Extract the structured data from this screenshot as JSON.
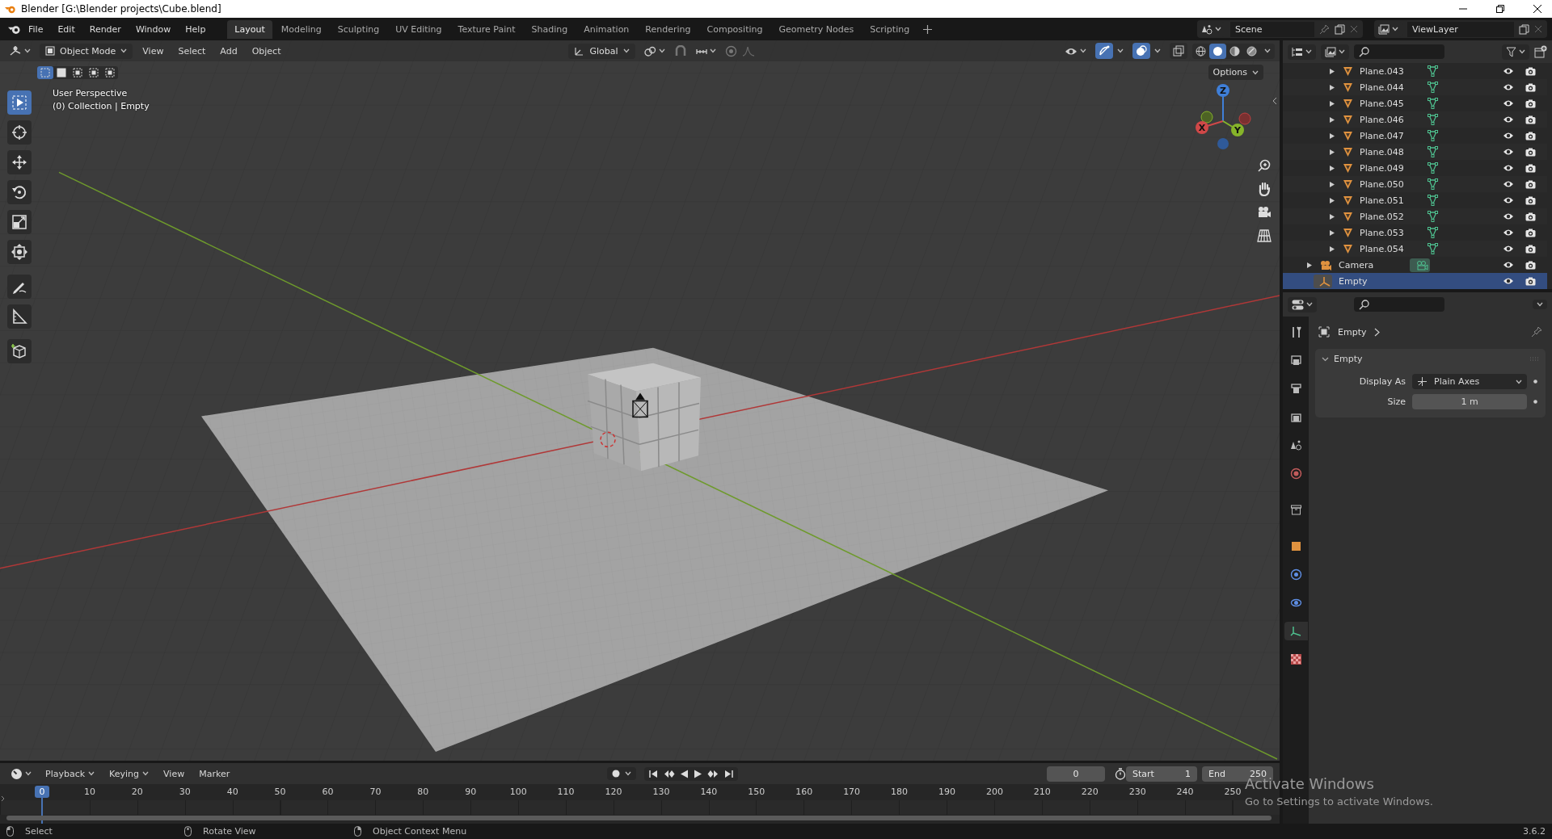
{
  "window": {
    "title": "Blender [G:\\Blender projects\\Cube.blend]"
  },
  "menu": [
    "File",
    "Edit",
    "Render",
    "Window",
    "Help"
  ],
  "workspaces": [
    {
      "label": "Layout",
      "selected": true
    },
    {
      "label": "Modeling",
      "selected": false
    },
    {
      "label": "Sculpting",
      "selected": false
    },
    {
      "label": "UV Editing",
      "selected": false
    },
    {
      "label": "Texture Paint",
      "selected": false
    },
    {
      "label": "Shading",
      "selected": false
    },
    {
      "label": "Animation",
      "selected": false
    },
    {
      "label": "Rendering",
      "selected": false
    },
    {
      "label": "Compositing",
      "selected": false
    },
    {
      "label": "Geometry Nodes",
      "selected": false
    },
    {
      "label": "Scripting",
      "selected": false
    }
  ],
  "scene": "Scene",
  "view_layer": "ViewLayer",
  "viewport": {
    "mode": "Object Mode",
    "menus": [
      "View",
      "Select",
      "Add",
      "Object"
    ],
    "orientation": "Global",
    "options": "Options",
    "info": [
      "User Perspective",
      "(0) Collection | Empty"
    ],
    "select_modes": [
      {
        "selected": true
      },
      {
        "selected": false
      },
      {
        "selected": false
      },
      {
        "selected": false
      },
      {
        "selected": false
      }
    ],
    "shading": [
      {
        "kind": "wireframe",
        "selected": false
      },
      {
        "kind": "solid",
        "selected": true
      },
      {
        "kind": "material",
        "selected": false
      },
      {
        "kind": "rendered",
        "selected": false
      }
    ],
    "tools": [
      {
        "kind": "select",
        "selected": true
      },
      {
        "kind": "cursor",
        "selected": false
      },
      {
        "kind": "move",
        "selected": false
      },
      {
        "kind": "rotate",
        "selected": false
      },
      {
        "kind": "scale",
        "selected": false
      },
      {
        "kind": "transform",
        "selected": false
      },
      {
        "kind": "annotate",
        "selected": false
      },
      {
        "kind": "measure",
        "selected": false
      },
      {
        "kind": "add-cube",
        "selected": false
      }
    ],
    "axes": [
      "Z",
      "X",
      "Y"
    ]
  },
  "outliner": {
    "items": [
      {
        "name": "Plane.043",
        "kind": "mesh",
        "selected": false
      },
      {
        "name": "Plane.044",
        "kind": "mesh",
        "selected": false
      },
      {
        "name": "Plane.045",
        "kind": "mesh",
        "selected": false
      },
      {
        "name": "Plane.046",
        "kind": "mesh",
        "selected": false
      },
      {
        "name": "Plane.047",
        "kind": "mesh",
        "selected": false
      },
      {
        "name": "Plane.048",
        "kind": "mesh",
        "selected": false
      },
      {
        "name": "Plane.049",
        "kind": "mesh",
        "selected": false
      },
      {
        "name": "Plane.050",
        "kind": "mesh",
        "selected": false
      },
      {
        "name": "Plane.051",
        "kind": "mesh",
        "selected": false
      },
      {
        "name": "Plane.052",
        "kind": "mesh",
        "selected": false
      },
      {
        "name": "Plane.053",
        "kind": "mesh",
        "selected": false
      },
      {
        "name": "Plane.054",
        "kind": "mesh",
        "selected": false
      },
      {
        "name": "Camera",
        "kind": "camera",
        "selected": false
      },
      {
        "name": "Empty",
        "kind": "empty",
        "selected": true
      }
    ]
  },
  "properties": {
    "tabs": [
      {
        "kind": "tool",
        "selected": false
      },
      {
        "kind": "render",
        "selected": false
      },
      {
        "kind": "output",
        "selected": false
      },
      {
        "kind": "view-layer",
        "selected": false
      },
      {
        "kind": "scene",
        "selected": false
      },
      {
        "kind": "world",
        "selected": false
      },
      {
        "kind": "collection",
        "selected": false
      },
      {
        "kind": "object",
        "selected": false
      },
      {
        "kind": "physics",
        "selected": false
      },
      {
        "kind": "constraints",
        "selected": false
      },
      {
        "kind": "data",
        "selected": true
      },
      {
        "kind": "texture",
        "selected": false
      }
    ],
    "object": "Empty",
    "panel": {
      "title": "Empty",
      "expanded": true
    },
    "fields": [
      {
        "label": "Display As",
        "value": "Plain Axes",
        "kind": "dropdown"
      },
      {
        "label": "Size",
        "value": "1 m",
        "kind": "number"
      }
    ]
  },
  "timeline": {
    "menus": [
      {
        "label": "Playback",
        "dropdown": true
      },
      {
        "label": "Keying",
        "dropdown": true
      },
      {
        "label": "View",
        "dropdown": false
      },
      {
        "label": "Marker",
        "dropdown": false
      }
    ],
    "current_frame": "0",
    "start_label": "Start",
    "start": "1",
    "end_label": "End",
    "end": "250",
    "playhead": "0",
    "ticks": [
      "10",
      "20",
      "30",
      "40",
      "50",
      "60",
      "70",
      "80",
      "90",
      "100",
      "110",
      "120",
      "130",
      "140",
      "150",
      "160",
      "170",
      "180",
      "190",
      "200",
      "210",
      "220",
      "230",
      "240",
      "250"
    ]
  },
  "status_bar": {
    "hints": [
      "Select",
      "Rotate View",
      "Object Context Menu"
    ],
    "version": "3.6.2"
  },
  "os_notice": {
    "title": "Activate Windows",
    "text": "Go to Settings to activate Windows."
  }
}
